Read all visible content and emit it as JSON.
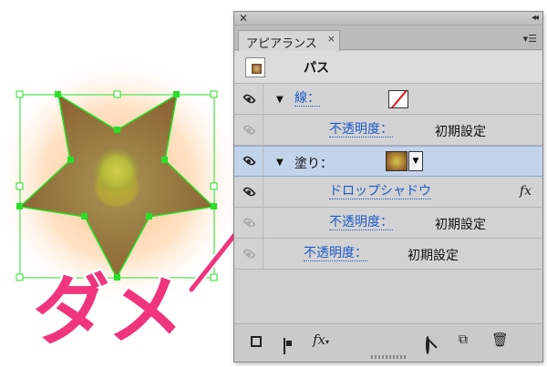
{
  "canvas": {
    "annotation_text": "ダメ",
    "annotation_color": "#f0357d",
    "star_outline_color": "#27e027"
  },
  "panel": {
    "title_close_icon": "close-icon",
    "title_collapse_icon": "collapse-icon",
    "tab_label": "アピアランス",
    "tab_close": "×",
    "menu_icon": "panel-menu-icon",
    "header": {
      "label": "パス"
    },
    "rows": [
      {
        "kind": "stroke",
        "label": "線：",
        "swatch": "none"
      },
      {
        "kind": "effect",
        "label": "不透明度：",
        "value": "初期設定"
      },
      {
        "kind": "fill",
        "label": "塗り：",
        "swatch": "gradient"
      },
      {
        "kind": "effect",
        "label": "ドロップシャドウ",
        "fx": "fx"
      },
      {
        "kind": "effect",
        "label": "不透明度：",
        "value": "初期設定"
      },
      {
        "kind": "effect",
        "label": "不透明度：",
        "value": "初期設定"
      }
    ],
    "bottom_icons": [
      "add-stroke-icon",
      "add-fill-icon",
      "fx-menu-icon",
      "clear-appearance-icon",
      "duplicate-icon",
      "trash-icon"
    ],
    "fx_label": "fx"
  },
  "colors": {
    "link": "#1f5bcc",
    "selected_row": "#c3d3ea",
    "panel_bg": "#d2d2d2"
  }
}
